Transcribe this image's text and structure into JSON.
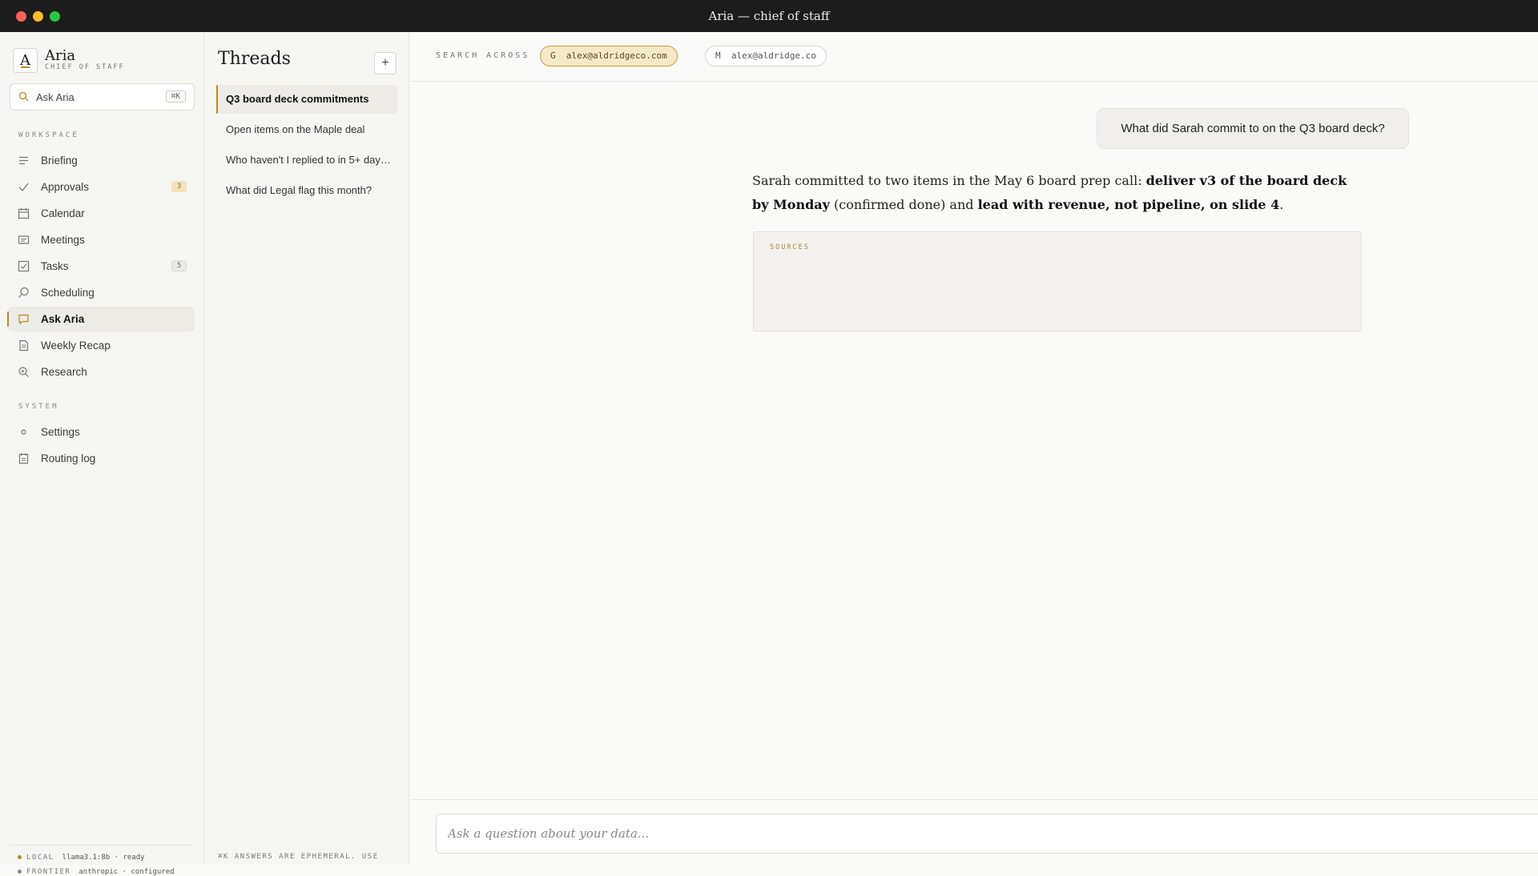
{
  "window": {
    "title": "Aria — chief of staff"
  },
  "brand": {
    "logo_letter": "A",
    "name": "Aria",
    "subtitle": "CHIEF OF STAFF"
  },
  "search": {
    "placeholder": "Ask Aria",
    "shortcut": "⌘K"
  },
  "sidebar": {
    "workspace_label": "WORKSPACE",
    "items": [
      {
        "label": "Briefing",
        "icon": "lines-icon"
      },
      {
        "label": "Approvals",
        "icon": "check-icon",
        "badge": "3"
      },
      {
        "label": "Calendar",
        "icon": "calendar-icon"
      },
      {
        "label": "Meetings",
        "icon": "meetings-icon"
      },
      {
        "label": "Tasks",
        "icon": "checkbox-icon",
        "badge": "5"
      },
      {
        "label": "Scheduling",
        "icon": "search-pin-icon"
      },
      {
        "label": "Ask Aria",
        "icon": "chat-icon",
        "active": true
      },
      {
        "label": "Weekly Recap",
        "icon": "document-icon"
      },
      {
        "label": "Research",
        "icon": "magnifier-icon"
      }
    ],
    "system_label": "SYSTEM",
    "system_items": [
      {
        "label": "Settings",
        "icon": "dot-icon"
      },
      {
        "label": "Routing log",
        "icon": "log-icon"
      }
    ],
    "status": [
      {
        "key": "LOCAL",
        "value": "llama3.1:8b · ready",
        "color": "#b8892b"
      },
      {
        "key": "FRONTIER",
        "value": "anthropic · configured",
        "color": "#8a877f"
      }
    ]
  },
  "threads": {
    "title": "Threads",
    "new_label": "+",
    "items": [
      {
        "label": "Q3 board deck commitments",
        "active": true
      },
      {
        "label": "Open items on the Maple deal"
      },
      {
        "label": "Who haven't I replied to in 5+ days?"
      },
      {
        "label": "What did Legal flag this month?"
      }
    ],
    "footer_note": "⌘K ANSWERS ARE EPHEMERAL. USE"
  },
  "main": {
    "search_across_label": "SEARCH ACROSS",
    "accounts": [
      {
        "prefix": "G",
        "email": "alex@aldridgeco.com",
        "selected": true
      },
      {
        "prefix": "M",
        "email": "alex@aldridge.co",
        "selected": false
      }
    ],
    "question": "What did Sarah commit to on the Q3 board deck?",
    "answer": {
      "part1": "Sarah committed to two items in the May 6 board prep call: ",
      "bold1": "deliver v3 of the board deck by Monday",
      "part2": " (confirmed done) and ",
      "bold2": "lead with revenue, not pipeline, on slide 4",
      "part3": "."
    },
    "sources_label": "SOURCES",
    "composer_placeholder": "Ask a question about your data..."
  },
  "colors": {
    "accent": "#b8892b",
    "titlebar": "#1c1c1c",
    "background": "#fafaf8"
  }
}
